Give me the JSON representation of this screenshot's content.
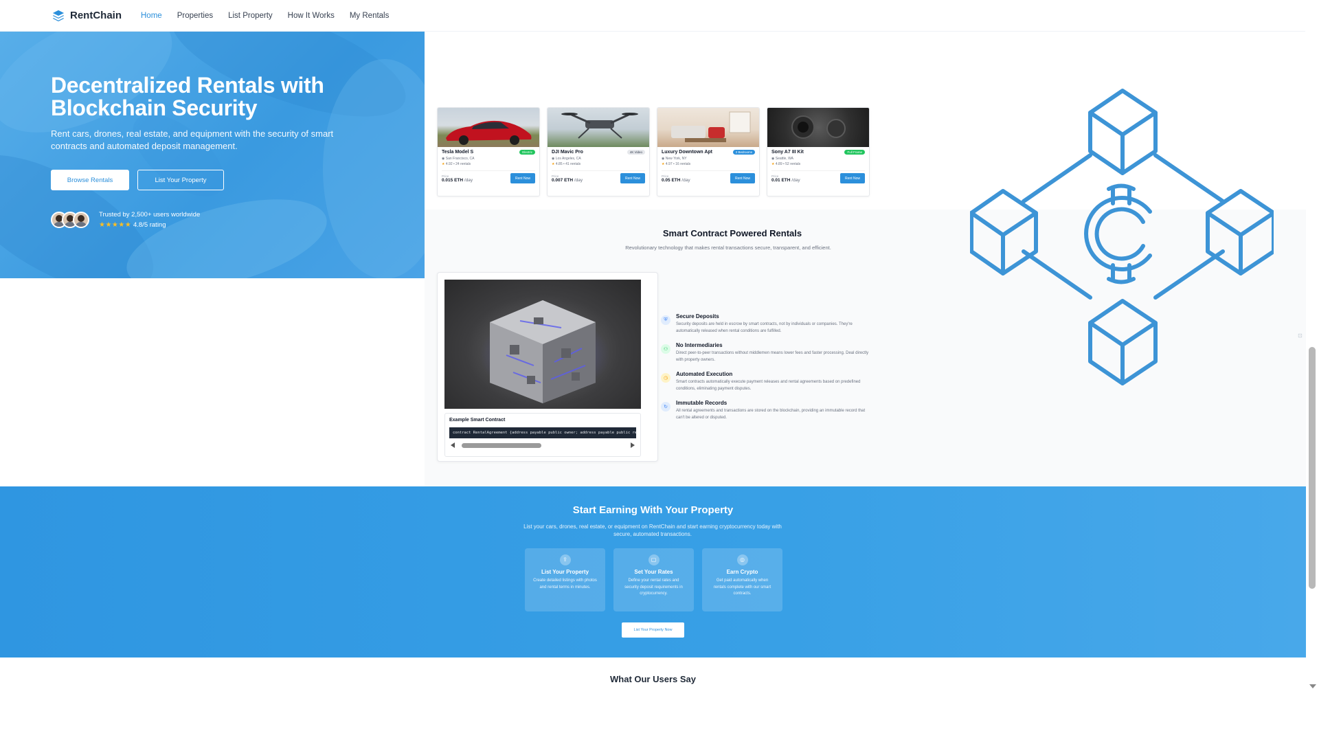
{
  "nav": {
    "brand": "RentChain",
    "links": [
      "Home",
      "Properties",
      "List Property",
      "How It Works",
      "My Rentals"
    ]
  },
  "hero": {
    "title": "Decentralized Rentals with Blockchain Security",
    "subtitle": "Rent cars, drones, real estate, and equipment with the security of smart contracts and automated deposit management.",
    "browse_btn": "Browse Rentals",
    "list_btn": "List Your Property",
    "trust_text": "Trusted by 2,500+ users worldwide",
    "stars": "★★★★★",
    "rating": "4.8/5 rating"
  },
  "rentals": [
    {
      "title": "Tesla Model S",
      "badge": "Electric",
      "badge_color": "#22c55e",
      "location": "San Francisco, CA",
      "rating": "4.92",
      "rentals": "24 rentals",
      "price_label": "Price",
      "price": "0.015 ETH",
      "unit": "/day",
      "button": "Rent Now"
    },
    {
      "title": "DJI Mavic Pro",
      "badge": "4K Video",
      "badge_color": "#e5e7eb",
      "location": "Los Angeles, CA",
      "rating": "4.85",
      "rentals": "41 rentals",
      "price_label": "Price",
      "price": "0.007 ETH",
      "unit": "/day",
      "button": "Rent Now"
    },
    {
      "title": "Luxury Downtown Apt",
      "badge": "2 Bedrooms",
      "badge_color": "#2b8fdb",
      "location": "New York, NY",
      "rating": "4.97",
      "rentals": "16 rentals",
      "price_label": "Price",
      "price": "0.05 ETH",
      "unit": "/day",
      "button": "Rent Now"
    },
    {
      "title": "Sony A7 III Kit",
      "badge": "Full Frame",
      "badge_color": "#22c55e",
      "location": "Seattle, WA",
      "rating": "4.89",
      "rentals": "52 rentals",
      "price_label": "Price",
      "price": "0.01 ETH",
      "unit": "/day",
      "button": "Rent Now"
    }
  ],
  "smart_contract": {
    "title": "Smart Contract Powered Rentals",
    "subtitle": "Revolutionary technology that makes rental transactions secure, transparent, and efficient.",
    "code_label": "Example Smart Contract",
    "code": "contract RentalAgreement {address payable public owner; address payable public renter;",
    "features": [
      {
        "icon": "shield-icon",
        "title": "Secure Deposits",
        "desc": "Security deposits are held in escrow by smart contracts, not by individuals or companies. They're automatically released when rental conditions are fulfilled.",
        "color": "#3b82f6"
      },
      {
        "icon": "users-icon",
        "title": "No Intermediaries",
        "desc": "Direct peer-to-peer transactions without middlemen means lower fees and faster processing. Deal directly with property owners.",
        "color": "#22c55e"
      },
      {
        "icon": "clock-icon",
        "title": "Automated Execution",
        "desc": "Smart contracts automatically execute payment releases and rental agreements based on predefined conditions, eliminating payment disputes.",
        "color": "#f59e0b"
      },
      {
        "icon": "refresh-icon",
        "title": "Immutable Records",
        "desc": "All rental agreements and transactions are stored on the blockchain, providing an immutable record that can't be altered or disputed.",
        "color": "#3b82f6"
      }
    ]
  },
  "earn": {
    "title": "Start Earning With Your Property",
    "subtitle": "List your cars, drones, real estate, or equipment on RentChain and start earning cryptocurrency today with secure, automated transactions.",
    "steps": [
      {
        "icon": "upload-icon",
        "title": "List Your Property",
        "desc": "Create detailed listings with photos and rental terms in minutes."
      },
      {
        "icon": "tag-icon",
        "title": "Set Your Rates",
        "desc": "Define your rental rates and security deposit requirements in cryptocurrency."
      },
      {
        "icon": "coin-icon",
        "title": "Earn Crypto",
        "desc": "Get paid automatically when rentals complete with our smart contracts."
      }
    ],
    "button": "List Your Property Now"
  },
  "testimonials": {
    "title": "What Our Users Say"
  },
  "colors": {
    "brand": "#2b8fdb",
    "hero": "#4aa3e6",
    "chain_graphic": "#3d94d6"
  }
}
